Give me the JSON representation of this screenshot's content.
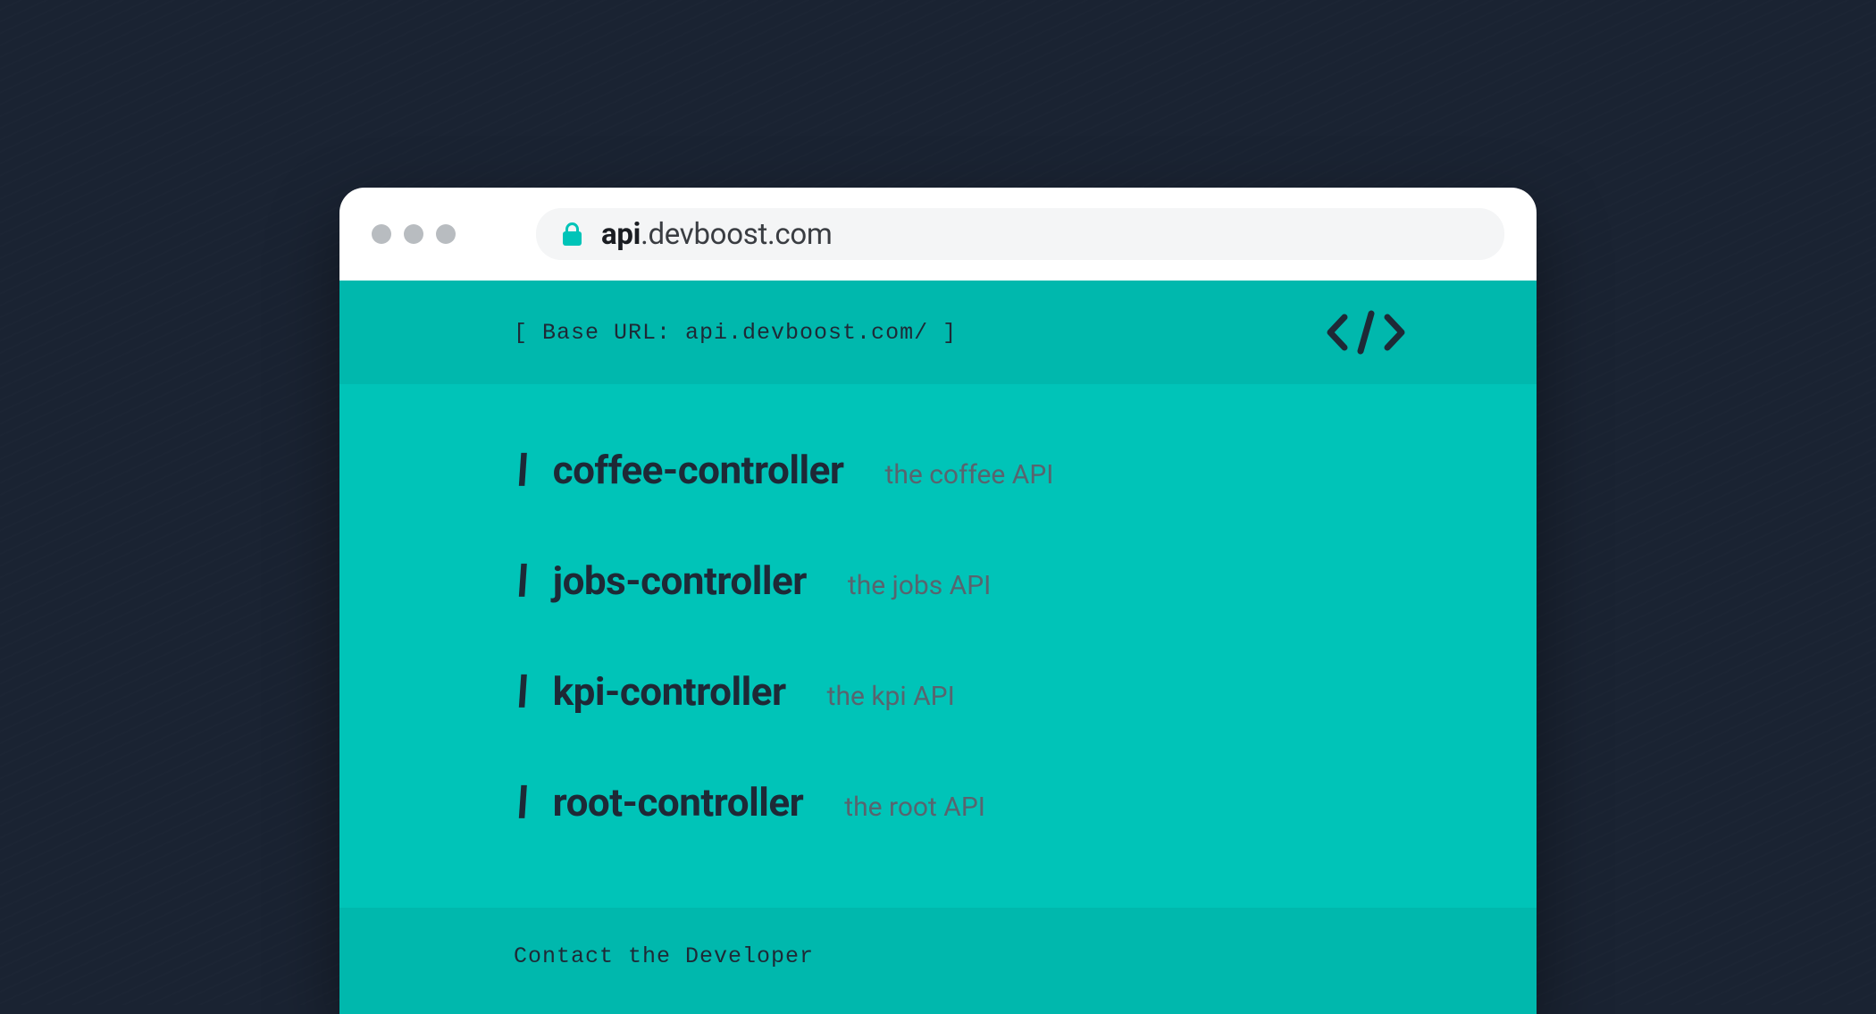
{
  "browser": {
    "url_bold": "api",
    "url_rest": ".devboost.com"
  },
  "banner": {
    "base_url_label": "[ Base URL: api.devboost.com/ ]"
  },
  "apis": [
    {
      "name": "coffee-controller",
      "desc": "the coffee API"
    },
    {
      "name": "jobs-controller",
      "desc": "the jobs API"
    },
    {
      "name": "kpi-controller",
      "desc": "the kpi API"
    },
    {
      "name": "root-controller",
      "desc": "the root API"
    }
  ],
  "footer": {
    "contact_label": "Contact the Developer"
  }
}
